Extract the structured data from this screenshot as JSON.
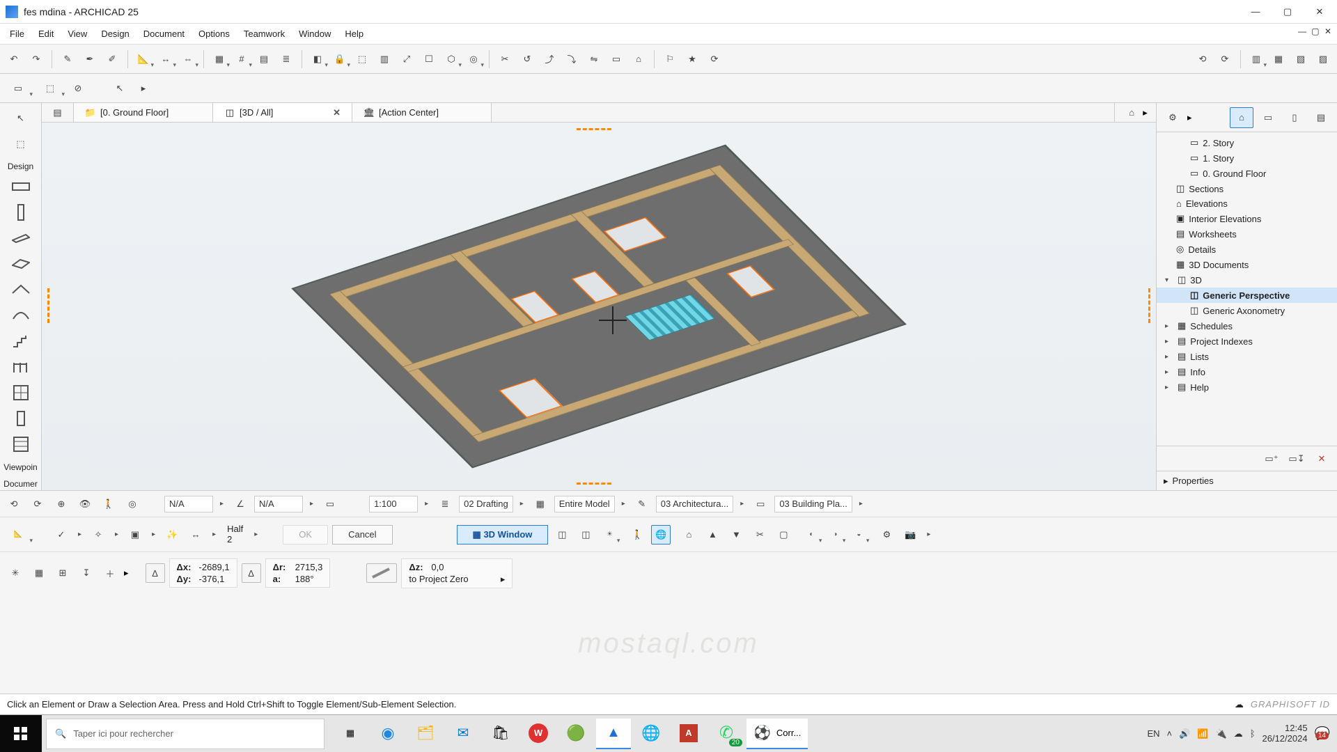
{
  "window": {
    "title": "fes mdina - ARCHICAD 25"
  },
  "menus": [
    "File",
    "Edit",
    "View",
    "Design",
    "Document",
    "Options",
    "Teamwork",
    "Window",
    "Help"
  ],
  "tabs": {
    "items": [
      {
        "label": "[0. Ground Floor]",
        "active": false,
        "closable": false
      },
      {
        "label": "[3D / All]",
        "active": true,
        "closable": true
      },
      {
        "label": "[Action Center]",
        "active": false,
        "closable": false
      }
    ]
  },
  "left_toolbox": {
    "section": "Design"
  },
  "viewpoint_label": "Viewpoin",
  "document_label": "Documer",
  "navigator": {
    "tree": [
      {
        "label": "2. Story",
        "indent": 2
      },
      {
        "label": "1. Story",
        "indent": 2
      },
      {
        "label": "0. Ground Floor",
        "indent": 2
      },
      {
        "label": "Sections",
        "indent": 1
      },
      {
        "label": "Elevations",
        "indent": 1
      },
      {
        "label": "Interior Elevations",
        "indent": 1
      },
      {
        "label": "Worksheets",
        "indent": 1
      },
      {
        "label": "Details",
        "indent": 1
      },
      {
        "label": "3D Documents",
        "indent": 1
      },
      {
        "label": "3D",
        "indent": 1,
        "expander": "▾"
      },
      {
        "label": "Generic Perspective",
        "indent": 2,
        "selected": true
      },
      {
        "label": "Generic Axonometry",
        "indent": 2
      },
      {
        "label": "Schedules",
        "indent": 1,
        "expander": "▸"
      },
      {
        "label": "Project Indexes",
        "indent": 1,
        "expander": "▸"
      },
      {
        "label": "Lists",
        "indent": 1,
        "expander": "▸"
      },
      {
        "label": "Info",
        "indent": 1,
        "expander": "▸"
      },
      {
        "label": "Help",
        "indent": 1,
        "expander": "▸"
      }
    ],
    "properties_label": "Properties"
  },
  "quick": {
    "zoom_na1": "N/A",
    "zoom_na2": "N/A",
    "scale": "1:100",
    "drafting": "02 Drafting",
    "model": "Entire Model",
    "arch": "03 Architectura...",
    "building_pla": "03 Building Pla..."
  },
  "info": {
    "half_label": "Half",
    "half_value": "2",
    "ok": "OK",
    "cancel": "Cancel",
    "window_btn": "3D Window"
  },
  "coords": {
    "dx_label": "Δx:",
    "dx": "-2689,1",
    "dy_label": "Δy:",
    "dy": "-376,1",
    "dr_label": "Δr:",
    "dr": "2715,3",
    "a_label": "a:",
    "a": "188°",
    "dz_label": "Δz:",
    "dz": "0,0",
    "ref": "to Project Zero"
  },
  "status": {
    "hint": "Click an Element or Draw a Selection Area. Press and Hold Ctrl+Shift to Toggle Element/Sub-Element Selection.",
    "brand": "GRAPHISOFT ID"
  },
  "taskbar": {
    "search_placeholder": "Taper ici pour rechercher",
    "lang": "EN",
    "app_label": "Corr...",
    "time": "12:45",
    "date": "26/12/2024",
    "whatsapp_badge": "20",
    "notif_badge": "14"
  }
}
